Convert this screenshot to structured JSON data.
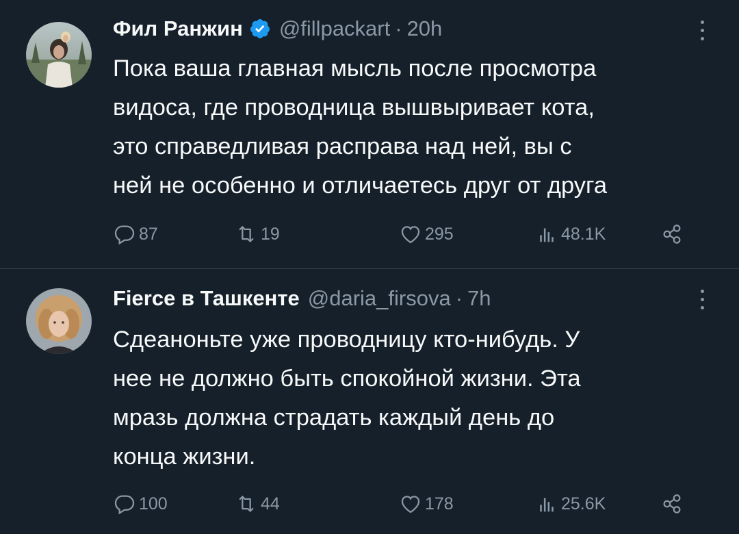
{
  "tweets": [
    {
      "name": "Фил Ранжин",
      "verified": true,
      "handle": "@fillpackart",
      "separator": "·",
      "time": "20h",
      "lines": [
        "Пока ваша главная мысль после просмотра",
        "видоса, где проводница вышвыривает кота,",
        "это справедливая расправа над ней, вы с",
        "ней не особенно и отличаетесь друг от друга"
      ],
      "stats": {
        "replies": "87",
        "retweets": "19",
        "likes": "295",
        "views": "48.1K"
      }
    },
    {
      "name": "Fierce в Ташкенте",
      "verified": false,
      "handle": "@daria_firsova",
      "separator": "·",
      "time": "7h",
      "lines": [
        "Сдеанонь­те уже проводницу кто-нибудь. У",
        "нее не должно быть спокойной жизни. Эта",
        "мразь должна страдать каждый день до",
        "конца жизни."
      ],
      "stats": {
        "replies": "100",
        "retweets": "44",
        "likes": "178",
        "views": "25.6K"
      }
    }
  ],
  "colors": {
    "background": "#15202b",
    "text_primary": "#f7f9f9",
    "text_secondary": "#8b98a5",
    "verified_badge": "#1d9bf0",
    "divider": "#38444d"
  },
  "icons": [
    "verified-badge-icon",
    "more-icon",
    "reply-icon",
    "retweet-icon",
    "like-icon",
    "views-icon",
    "share-icon"
  ]
}
